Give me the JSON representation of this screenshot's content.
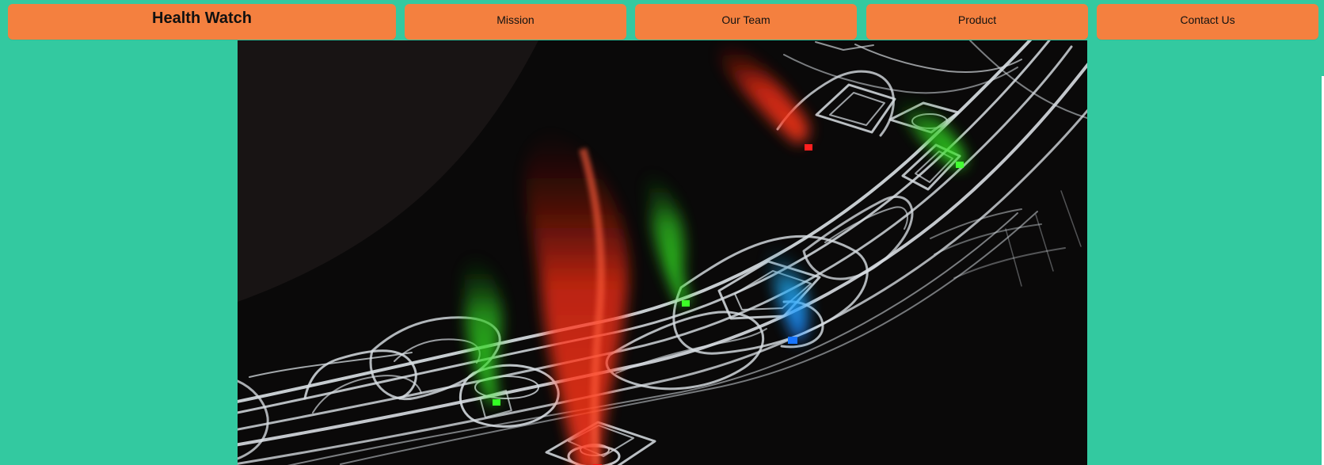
{
  "nav": {
    "brand": "Health Watch",
    "items": [
      {
        "label": "Mission"
      },
      {
        "label": "Our Team"
      },
      {
        "label": "Product"
      },
      {
        "label": "Contact Us"
      }
    ]
  },
  "colors": {
    "page_background": "#33c9a0",
    "nav_background": "#f4803f",
    "nav_text": "#111111",
    "hero_background": "#070707",
    "wireframe": "#d7dde2",
    "plume_red": "#ff4a21",
    "plume_green": "#3ddf32",
    "plume_blue": "#25a9ff"
  },
  "hero": {
    "subject": "wireframe-ring-device-with-colored-light-plumes",
    "icons": [
      "wireframe-device",
      "red-light-plume",
      "green-light-plume",
      "blue-light-plume"
    ]
  }
}
